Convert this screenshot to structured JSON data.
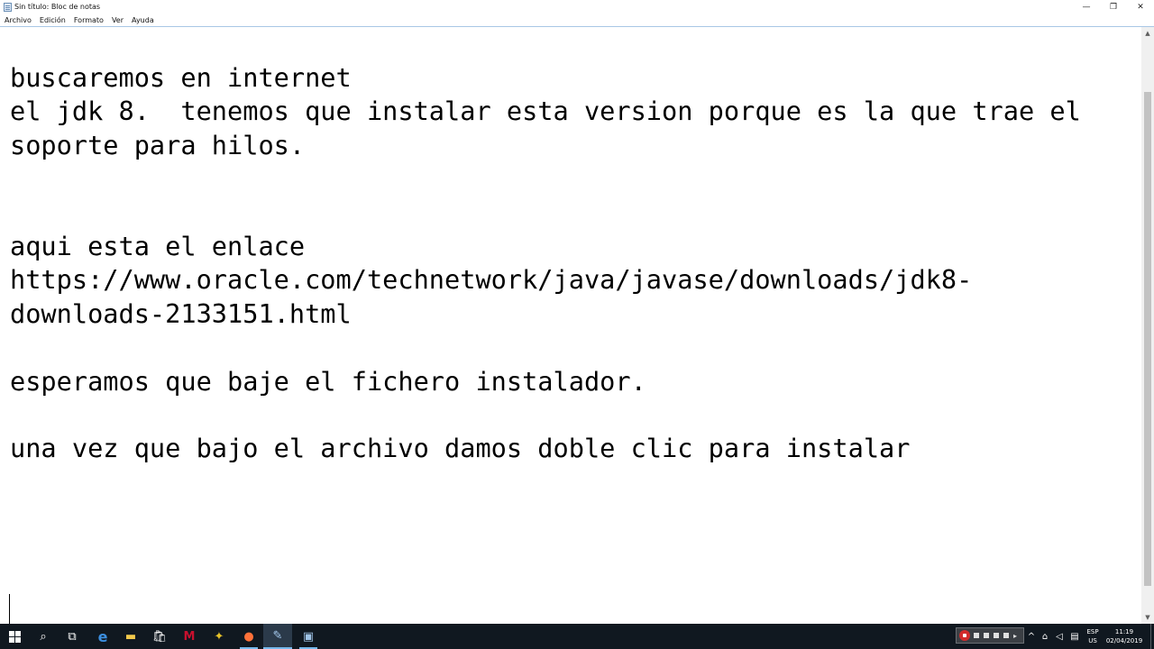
{
  "window": {
    "title": "Sin título: Bloc de notas",
    "minimize_glyph": "—",
    "maximize_glyph": "❐",
    "close_glyph": "✕"
  },
  "menu": {
    "items": [
      "Archivo",
      "Edición",
      "Formato",
      "Ver",
      "Ayuda"
    ]
  },
  "editor": {
    "content": "buscaremos en internet\nel jdk 8.  tenemos que instalar esta version porque es la que trae el\nsoporte para hilos.\n\n\naqui esta el enlace\nhttps://www.oracle.com/technetwork/java/javase/downloads/jdk8-\ndownloads-2133151.html\n\nesperamos que baje el fichero instalador.\n\nuna vez que bajo el archivo damos doble clic para instalar"
  },
  "scrollbar": {
    "up_glyph": "▲",
    "down_glyph": "▼"
  },
  "taskbar": {
    "pinned": [
      {
        "name": "start-button",
        "icon": "windows-logo"
      },
      {
        "name": "search-icon",
        "glyph": "⌕"
      },
      {
        "name": "task-view-icon",
        "glyph": "⧉"
      },
      {
        "name": "edge-icon",
        "glyph": "e",
        "color": "#3c8fe0"
      },
      {
        "name": "file-explorer-icon",
        "glyph": "▬",
        "color": "#f2c94c"
      },
      {
        "name": "store-icon",
        "glyph": "🛍"
      },
      {
        "name": "mcafee-icon",
        "glyph": "M",
        "color": "#c8102e"
      },
      {
        "name": "app-yellow-icon",
        "glyph": "✦",
        "color": "#e6c229"
      },
      {
        "name": "firefox-icon",
        "glyph": "●",
        "color": "#ff7139"
      },
      {
        "name": "notepad-icon",
        "glyph": "✎",
        "color": "#a6cbef"
      },
      {
        "name": "app-network-icon",
        "glyph": "▣",
        "color": "#9fc3e6"
      }
    ],
    "tray": {
      "chevron_glyph": "^",
      "network_glyph": "⌂",
      "volume_glyph": "◁",
      "notification_glyph": "▤",
      "language_top": "ESP",
      "language_bottom": "US",
      "time": "11:19",
      "date": "02/04/2019"
    }
  },
  "colors": {
    "taskbar_bg": "#101820",
    "accent": "#76b9ed",
    "window_border": "#a9c7e5"
  }
}
